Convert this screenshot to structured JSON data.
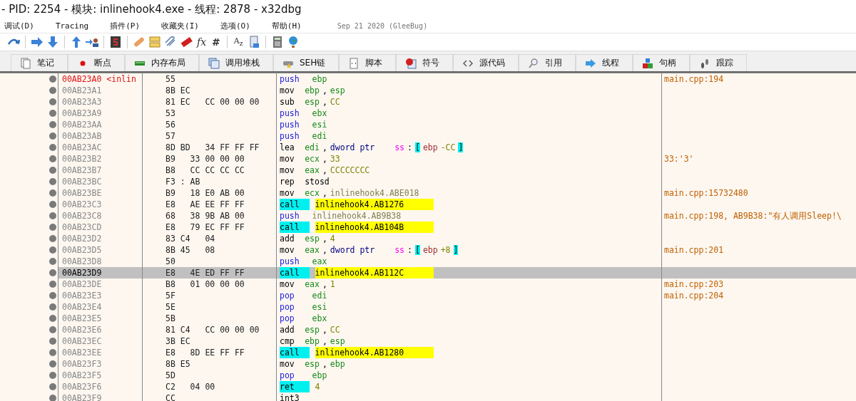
{
  "window": {
    "title": "- PID: 2254 - 模块: inlinehook4.exe - 线程: 2878 - x32dbg"
  },
  "menu": [
    "调试(D)",
    "Tracing",
    "插件(P)",
    "收藏夹(I)",
    "选项(O)",
    "帮助(H)"
  ],
  "build_info": "Sep 21 2020 (GleeBug)",
  "toolbar": {
    "glyphs": [
      "fx",
      "#",
      "A$_{z}$"
    ]
  },
  "tabs": [
    {
      "label": "笔记",
      "selected": false
    },
    {
      "label": "断点",
      "selected": false
    },
    {
      "label": "内存布局",
      "selected": false
    },
    {
      "label": "调用堆栈",
      "selected": false
    },
    {
      "label": "SEH链",
      "selected": false
    },
    {
      "label": "脚本",
      "selected": false
    },
    {
      "label": "符号",
      "selected": false
    },
    {
      "label": "源代码",
      "selected": false
    },
    {
      "label": "引用",
      "selected": false
    },
    {
      "label": "线程",
      "selected": false
    },
    {
      "label": "句柄",
      "selected": false
    },
    {
      "label": "跟踪",
      "selected": false
    }
  ],
  "rows": [
    {
      "address": "00AB23A0 <inlin",
      "entry": true,
      "selected": false,
      "bytes": "55",
      "instr": [
        {
          "kind": "stack",
          "text": "push"
        },
        {
          "kind": "reg",
          "text": "ebp"
        }
      ],
      "comment": "main.cpp:194"
    },
    {
      "address": "00AB23A1",
      "entry": false,
      "selected": false,
      "bytes": "8B EC",
      "instr": [
        {
          "kind": "op",
          "text": "mov"
        },
        {
          "kind": "reg",
          "text": "ebp"
        },
        {
          "kind": "punct",
          "text": ","
        },
        {
          "kind": "reg",
          "text": "esp"
        }
      ]
    },
    {
      "address": "00AB23A3",
      "entry": false,
      "selected": false,
      "bytes": "81 EC   CC 00 00 00",
      "instr": [
        {
          "kind": "op",
          "text": "sub"
        },
        {
          "kind": "reg",
          "text": "esp"
        },
        {
          "kind": "punct",
          "text": ","
        },
        {
          "kind": "num",
          "text": "CC"
        }
      ]
    },
    {
      "address": "00AB23A9",
      "entry": false,
      "selected": false,
      "bytes": "53",
      "instr": [
        {
          "kind": "stack",
          "text": "push"
        },
        {
          "kind": "reg",
          "text": "ebx"
        }
      ]
    },
    {
      "address": "00AB23AA",
      "entry": false,
      "selected": false,
      "bytes": "56",
      "instr": [
        {
          "kind": "stack",
          "text": "push"
        },
        {
          "kind": "reg",
          "text": "esi"
        }
      ]
    },
    {
      "address": "00AB23AB",
      "entry": false,
      "selected": false,
      "bytes": "57",
      "instr": [
        {
          "kind": "stack",
          "text": "push"
        },
        {
          "kind": "reg",
          "text": "edi"
        }
      ]
    },
    {
      "address": "00AB23AC",
      "entry": false,
      "selected": false,
      "bytes": "8D BD   34 FF FF FF",
      "instr": [
        {
          "kind": "op",
          "text": "lea"
        },
        {
          "kind": "reg",
          "text": "edi"
        },
        {
          "kind": "punct",
          "text": ","
        },
        {
          "kind": "size",
          "text": "dword ptr"
        },
        {
          "kind": "seg",
          "text": "ss"
        },
        {
          "kind": "punct",
          "text": ":"
        },
        {
          "kind": "bracket",
          "text": "["
        },
        {
          "kind": "memreg",
          "text": "ebp"
        },
        {
          "kind": "num",
          "text": "-CC"
        },
        {
          "kind": "bracket",
          "text": "]"
        }
      ]
    },
    {
      "address": "00AB23B2",
      "entry": false,
      "selected": false,
      "bytes": "B9   33 00 00 00",
      "instr": [
        {
          "kind": "op",
          "text": "mov"
        },
        {
          "kind": "reg",
          "text": "ecx"
        },
        {
          "kind": "punct",
          "text": ","
        },
        {
          "kind": "num",
          "text": "33"
        }
      ],
      "comment": "33:'3'"
    },
    {
      "address": "00AB23B7",
      "entry": false,
      "selected": false,
      "bytes": "B8   CC CC CC CC",
      "instr": [
        {
          "kind": "op",
          "text": "mov"
        },
        {
          "kind": "reg",
          "text": "eax"
        },
        {
          "kind": "punct",
          "text": ","
        },
        {
          "kind": "num",
          "text": "CCCCCCCC"
        }
      ]
    },
    {
      "address": "00AB23BC",
      "entry": false,
      "selected": false,
      "bytes": "F3 : AB",
      "instr": [
        {
          "kind": "op",
          "text": "rep"
        },
        {
          "kind": "op",
          "text": "stosd"
        }
      ]
    },
    {
      "address": "00AB23BE",
      "entry": false,
      "selected": false,
      "bytes": "B9   18 E0 AB 00",
      "instr": [
        {
          "kind": "op",
          "text": "mov"
        },
        {
          "kind": "reg",
          "text": "ecx"
        },
        {
          "kind": "punct",
          "text": ","
        },
        {
          "kind": "sym",
          "text": "inlinehook4.ABE018"
        }
      ],
      "comment": "main.cpp:15732480"
    },
    {
      "address": "00AB23C3",
      "entry": false,
      "selected": false,
      "bytes": "E8   AE EE FF FF",
      "instr": [
        {
          "kind": "call",
          "text": "call"
        },
        {
          "kind": "target",
          "text": "inlinehook4.AB1276"
        }
      ]
    },
    {
      "address": "00AB23C8",
      "entry": false,
      "selected": false,
      "bytes": "68   38 9B AB 00",
      "instr": [
        {
          "kind": "stack",
          "text": "push"
        },
        {
          "kind": "sym",
          "text": "inlinehook4.AB9B38"
        }
      ],
      "comment": "main.cpp:198, AB9B38:\"有人调用Sleep!\\"
    },
    {
      "address": "00AB23CD",
      "entry": false,
      "selected": false,
      "bytes": "E8   79 EC FF FF",
      "instr": [
        {
          "kind": "call",
          "text": "call"
        },
        {
          "kind": "target",
          "text": "inlinehook4.AB104B"
        }
      ]
    },
    {
      "address": "00AB23D2",
      "entry": false,
      "selected": false,
      "bytes": "83 C4   04",
      "instr": [
        {
          "kind": "op",
          "text": "add"
        },
        {
          "kind": "reg",
          "text": "esp"
        },
        {
          "kind": "punct",
          "text": ","
        },
        {
          "kind": "num",
          "text": "4"
        }
      ]
    },
    {
      "address": "00AB23D5",
      "entry": false,
      "selected": false,
      "bytes": "8B 45   08",
      "instr": [
        {
          "kind": "op",
          "text": "mov"
        },
        {
          "kind": "reg",
          "text": "eax"
        },
        {
          "kind": "punct",
          "text": ","
        },
        {
          "kind": "size",
          "text": "dword ptr"
        },
        {
          "kind": "seg",
          "text": "ss"
        },
        {
          "kind": "punct",
          "text": ":"
        },
        {
          "kind": "bracket",
          "text": "["
        },
        {
          "kind": "memreg",
          "text": "ebp"
        },
        {
          "kind": "num",
          "text": "+8"
        },
        {
          "kind": "bracket",
          "text": "]"
        }
      ],
      "comment": "main.cpp:201"
    },
    {
      "address": "00AB23D8",
      "entry": false,
      "selected": false,
      "bytes": "50",
      "instr": [
        {
          "kind": "stack",
          "text": "push"
        },
        {
          "kind": "reg",
          "text": "eax"
        }
      ]
    },
    {
      "address": "00AB23D9",
      "entry": false,
      "selected": true,
      "bytes": "E8   4E ED FF FF",
      "instr": [
        {
          "kind": "call",
          "text": "call"
        },
        {
          "kind": "target",
          "text": "inlinehook4.AB112C"
        }
      ]
    },
    {
      "address": "00AB23DE",
      "entry": false,
      "selected": false,
      "bytes": "B8   01 00 00 00",
      "instr": [
        {
          "kind": "op",
          "text": "mov"
        },
        {
          "kind": "reg",
          "text": "eax"
        },
        {
          "kind": "punct",
          "text": ","
        },
        {
          "kind": "num",
          "text": "1"
        }
      ],
      "comment": "main.cpp:203"
    },
    {
      "address": "00AB23E3",
      "entry": false,
      "selected": false,
      "bytes": "5F",
      "instr": [
        {
          "kind": "stack",
          "text": "pop"
        },
        {
          "kind": "reg",
          "text": "edi"
        }
      ],
      "comment": "main.cpp:204"
    },
    {
      "address": "00AB23E4",
      "entry": false,
      "selected": false,
      "bytes": "5E",
      "instr": [
        {
          "kind": "stack",
          "text": "pop"
        },
        {
          "kind": "reg",
          "text": "esi"
        }
      ]
    },
    {
      "address": "00AB23E5",
      "entry": false,
      "selected": false,
      "bytes": "5B",
      "instr": [
        {
          "kind": "stack",
          "text": "pop"
        },
        {
          "kind": "reg",
          "text": "ebx"
        }
      ]
    },
    {
      "address": "00AB23E6",
      "entry": false,
      "selected": false,
      "bytes": "81 C4   CC 00 00 00",
      "instr": [
        {
          "kind": "op",
          "text": "add"
        },
        {
          "kind": "reg",
          "text": "esp"
        },
        {
          "kind": "punct",
          "text": ","
        },
        {
          "kind": "num",
          "text": "CC"
        }
      ]
    },
    {
      "address": "00AB23EC",
      "entry": false,
      "selected": false,
      "bytes": "3B EC",
      "instr": [
        {
          "kind": "op",
          "text": "cmp"
        },
        {
          "kind": "reg",
          "text": "ebp"
        },
        {
          "kind": "punct",
          "text": ","
        },
        {
          "kind": "reg",
          "text": "esp"
        }
      ]
    },
    {
      "address": "00AB23EE",
      "entry": false,
      "selected": false,
      "bytes": "E8   8D EE FF FF",
      "instr": [
        {
          "kind": "call",
          "text": "call"
        },
        {
          "kind": "target",
          "text": "inlinehook4.AB1280"
        }
      ]
    },
    {
      "address": "00AB23F3",
      "entry": false,
      "selected": false,
      "bytes": "8B E5",
      "instr": [
        {
          "kind": "op",
          "text": "mov"
        },
        {
          "kind": "reg",
          "text": "esp"
        },
        {
          "kind": "punct",
          "text": ","
        },
        {
          "kind": "reg",
          "text": "ebp"
        }
      ]
    },
    {
      "address": "00AB23F5",
      "entry": false,
      "selected": false,
      "bytes": "5D",
      "instr": [
        {
          "kind": "stack",
          "text": "pop"
        },
        {
          "kind": "reg",
          "text": "ebp"
        }
      ]
    },
    {
      "address": "00AB23F6",
      "entry": false,
      "selected": false,
      "bytes": "C2   04 00",
      "instr": [
        {
          "kind": "call",
          "text": "ret"
        },
        {
          "kind": "num",
          "text": "4"
        }
      ]
    },
    {
      "address": "00AB23F9",
      "entry": false,
      "selected": false,
      "bytes": "CC",
      "instr": [
        {
          "kind": "op",
          "text": "int3"
        }
      ]
    }
  ]
}
